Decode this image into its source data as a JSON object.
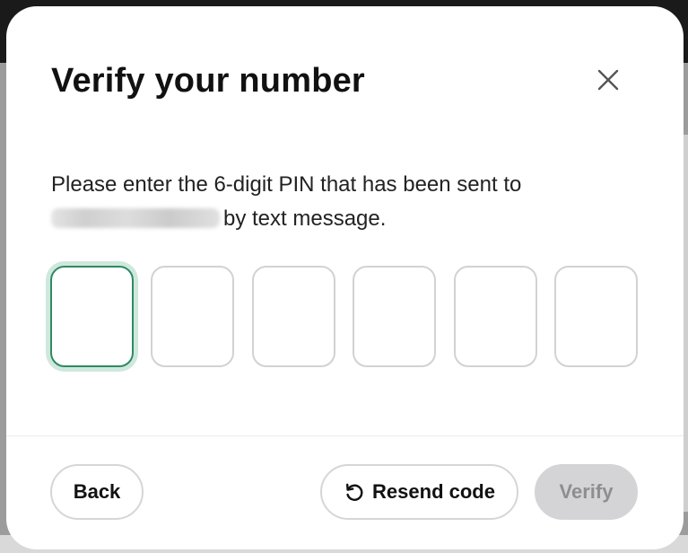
{
  "dialog": {
    "title": "Verify your number",
    "instructions_line1": "Please enter the 6-digit PIN that has been sent to",
    "instructions_line2": "by text message.",
    "pin_length": 6,
    "pin_values": [
      "",
      "",
      "",
      "",
      "",
      ""
    ]
  },
  "buttons": {
    "back": "Back",
    "resend": "Resend code",
    "verify": "Verify"
  },
  "colors": {
    "active_border": "#2f8a63",
    "active_glow": "#cfe8dd",
    "disabled_bg": "#d4d4d6",
    "disabled_text": "#8e8e92"
  },
  "icons": {
    "close": "close-icon",
    "resend": "refresh-icon"
  }
}
